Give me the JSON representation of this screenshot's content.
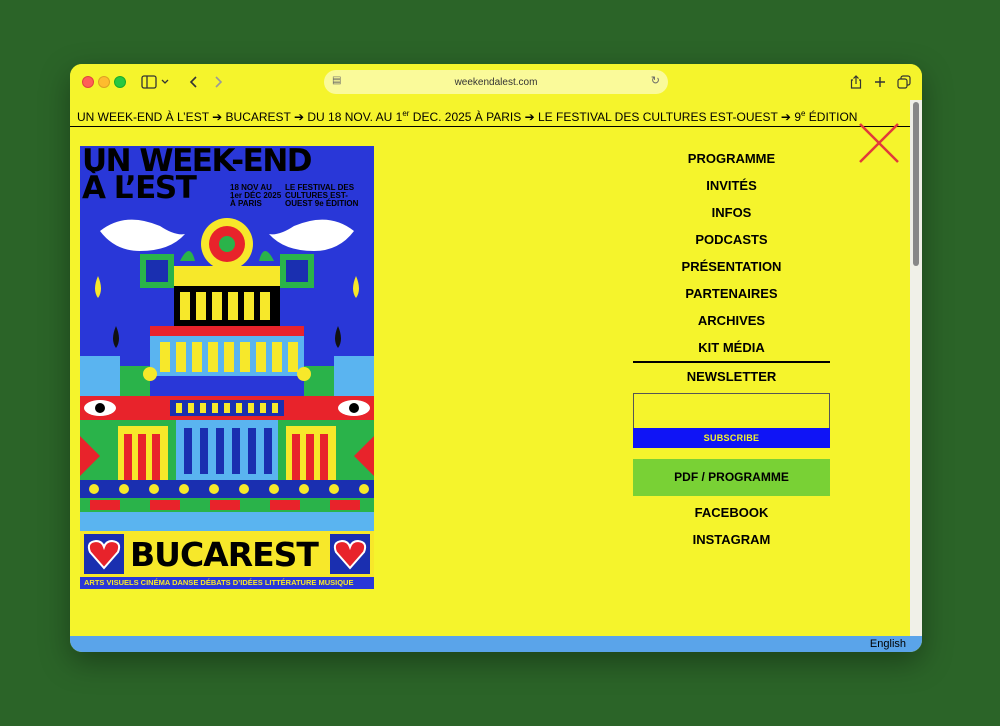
{
  "browser": {
    "url": "weekendalest.com"
  },
  "marquee": {
    "part1": "UN WEEK-END À L’EST ➔  BUCAREST ➔ DU 18 NOV. AU 1",
    "sup1": "er",
    "part2": " DEC. 2025 À PARIS ➔ LE FESTIVAL DES CULTURES EST-OUEST ➔ 9",
    "sup2": "e",
    "part3": " ÉDITION"
  },
  "poster": {
    "title_line1": "UN WEEK-END",
    "title_line2": "À L’EST",
    "date": "18 NOV AU 1er DÉC 2025 À PARIS",
    "festival": "LE FESTIVAL DES CULTURES EST-OUEST 9e ÉDITION",
    "city": "BUCAREST",
    "disciplines": "ARTS VISUELS  CINÉMA  DANSE  DÉBATS D’IDÉES  LITTÉRATURE  MUSIQUE"
  },
  "menu": {
    "items": [
      "PROGRAMME",
      "INVITÉS",
      "INFOS",
      "PODCASTS",
      "PRÉSENTATION",
      "PARTENAIRES",
      "ARCHIVES",
      "KIT MÉDIA"
    ],
    "newsletter_title": "NEWSLETTER",
    "subscribe_label": "SUBSCRIBE",
    "pdf_label": "PDF /  PROGRAMME",
    "facebook_label": "FACEBOOK",
    "instagram_label": "INSTAGRAM"
  },
  "footer": {
    "language": "English"
  },
  "colors": {
    "page_bg": "#f5f42c",
    "subscribe_bg": "#0f14f6",
    "pdf_bg": "#79d135",
    "footer_bg": "#5aa4ea",
    "close_x": "#e23a3a"
  }
}
